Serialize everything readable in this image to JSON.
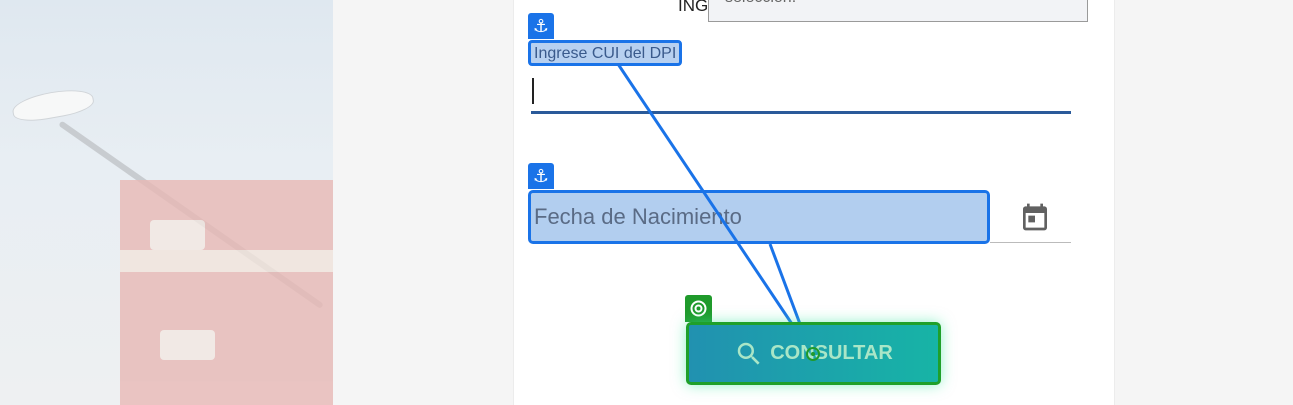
{
  "background": {
    "photo": "city-building-with-street-lamp"
  },
  "tooltip": {
    "text": "selección."
  },
  "header_fragment": {
    "text": "ING"
  },
  "form": {
    "cui_label": "Ingrese CUI del DPI",
    "cui_value": "",
    "fecha_placeholder": "Fecha de Nacimiento",
    "submit_label": "CONSULTAR"
  },
  "icons": {
    "anchor": "anchor-icon",
    "calendar": "calendar-icon",
    "search": "search-icon",
    "target": "target-icon"
  },
  "colors": {
    "highlight_blue": "#1a73e8",
    "highlight_green": "#1f9a2b",
    "button_gradient_start": "#2191b0",
    "button_gradient_end": "#17b4a6",
    "input_underline": "#2a5a9a"
  }
}
